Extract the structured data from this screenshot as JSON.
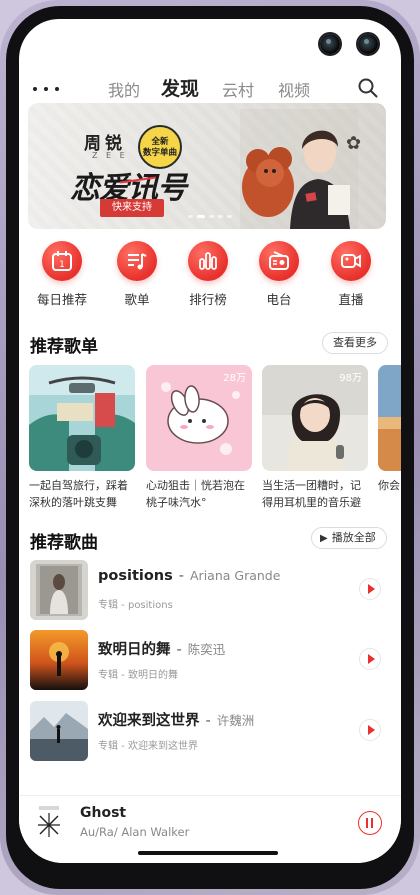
{
  "topnav": {
    "tabs": [
      "我的",
      "发现",
      "云村",
      "视频"
    ],
    "active_tab": "发现"
  },
  "banner": {
    "artist": "周锐",
    "artist_latin": "Z E E",
    "badge": "全新\n数字单曲",
    "title": "恋爱讯号",
    "cta": "快来支持"
  },
  "quick_entries": [
    {
      "label": "每日推荐",
      "icon": "calendar-icon"
    },
    {
      "label": "歌单",
      "icon": "playlist-icon"
    },
    {
      "label": "排行榜",
      "icon": "chart-icon"
    },
    {
      "label": "电台",
      "icon": "radio-icon"
    },
    {
      "label": "直播",
      "icon": "live-camera-icon"
    }
  ],
  "playlists_section": {
    "title": "推荐歌单",
    "more": "查看更多",
    "items": [
      {
        "name": "一起自驾旅行，踩着深秋的落叶跳支舞",
        "count": ""
      },
      {
        "name": "心动狙击｜恍若泡在桃子味汽水°",
        "count": "28万"
      },
      {
        "name": "当生活一团糟时，记得用耳机里的音乐避难",
        "count": "98万"
      },
      {
        "name": "你会",
        "count": ""
      }
    ]
  },
  "songs_section": {
    "title": "推荐歌曲",
    "play_all": "播放全部",
    "items": [
      {
        "title": "positions",
        "artist": "Ariana Grande",
        "album": "专辑 - positions"
      },
      {
        "title": "致明日的舞",
        "artist": "陈奕迅",
        "album": "专辑 - 致明日的舞"
      },
      {
        "title": "欢迎来到这世界",
        "artist": "许魏洲",
        "album": "专辑 - 欢迎来到这世界"
      }
    ]
  },
  "mini_player": {
    "title": "Ghost",
    "artist": "Au/Ra/ Alan Walker"
  },
  "colors": {
    "accent": "#e8312c",
    "text": "#222222",
    "muted": "#888888"
  }
}
